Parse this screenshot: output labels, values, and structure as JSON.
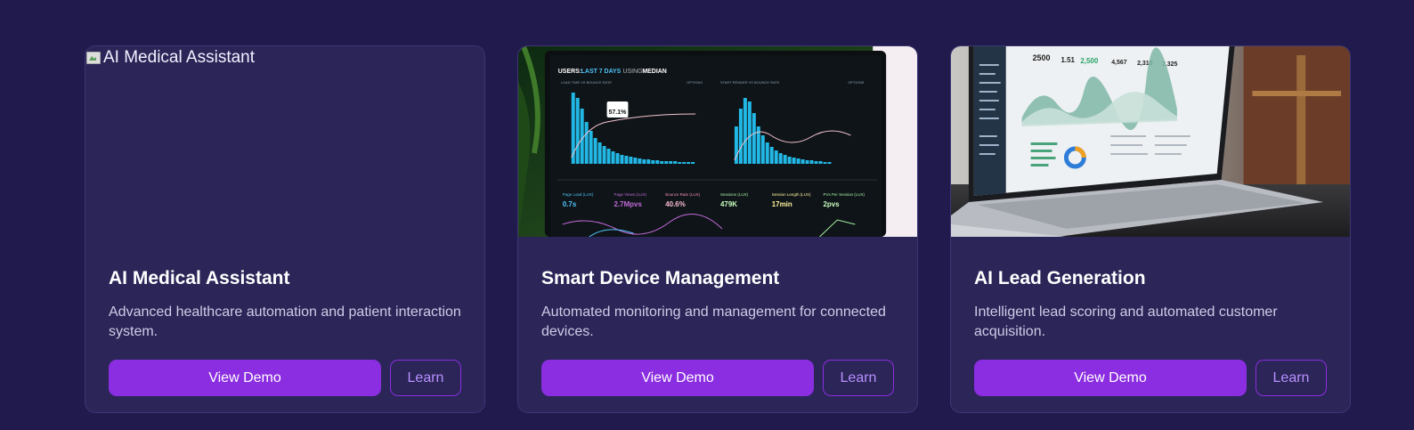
{
  "cards": [
    {
      "image_alt": "AI Medical Assistant",
      "title": "AI Medical Assistant",
      "description": "Advanced healthcare automation and patient interaction system.",
      "primary_label": "View Demo",
      "secondary_label": "Learn"
    },
    {
      "image_alt": "Smart Device Management",
      "screen": {
        "header_users": "USERS:",
        "header_last": "LAST 7 DAYS",
        "header_using": "USING",
        "header_median": "MEDIAN",
        "panel_left_title": "LOAD TIME VS BOUNCE RATE",
        "panel_right_title": "START RENDER VS BOUNCE RATE",
        "options": "OPTIONS",
        "tooltip_value": "57.1%",
        "metric_1_label": "Page Load (LUX)",
        "metric_1_value": "0.7s",
        "metric_2_label": "Page Views (LUX)",
        "metric_2_value": "2.7Mpvs",
        "metric_3_label": "Bounce Rate (LUX)",
        "metric_3_value": "40.6%",
        "metric_4_label": "Sessions (LUX)",
        "metric_4_value": "479K",
        "metric_5_label": "Session Length (LUX)",
        "metric_5_value": "17min",
        "metric_6_label": "PVs Per Session (LUX)",
        "metric_6_value": "2pvs"
      },
      "title": "Smart Device Management",
      "description": "Automated monitoring and management for connected devices.",
      "primary_label": "View Demo",
      "secondary_label": "Learn"
    },
    {
      "image_alt": "AI Lead Generation",
      "screen": {
        "stat_1": "2500",
        "stat_2": "1.51",
        "stat_3": "2,500",
        "stat_4": "4,567",
        "stat_5": "2,315",
        "stat_6": "7,325"
      },
      "title": "AI Lead Generation",
      "description": "Intelligent lead scoring and automated customer acquisition.",
      "primary_label": "View Demo",
      "secondary_label": "Learn"
    }
  ],
  "colors": {
    "background": "#201a4d",
    "card": "#2b2558",
    "accent": "#8b2de0",
    "outline_text": "#b890ff"
  }
}
